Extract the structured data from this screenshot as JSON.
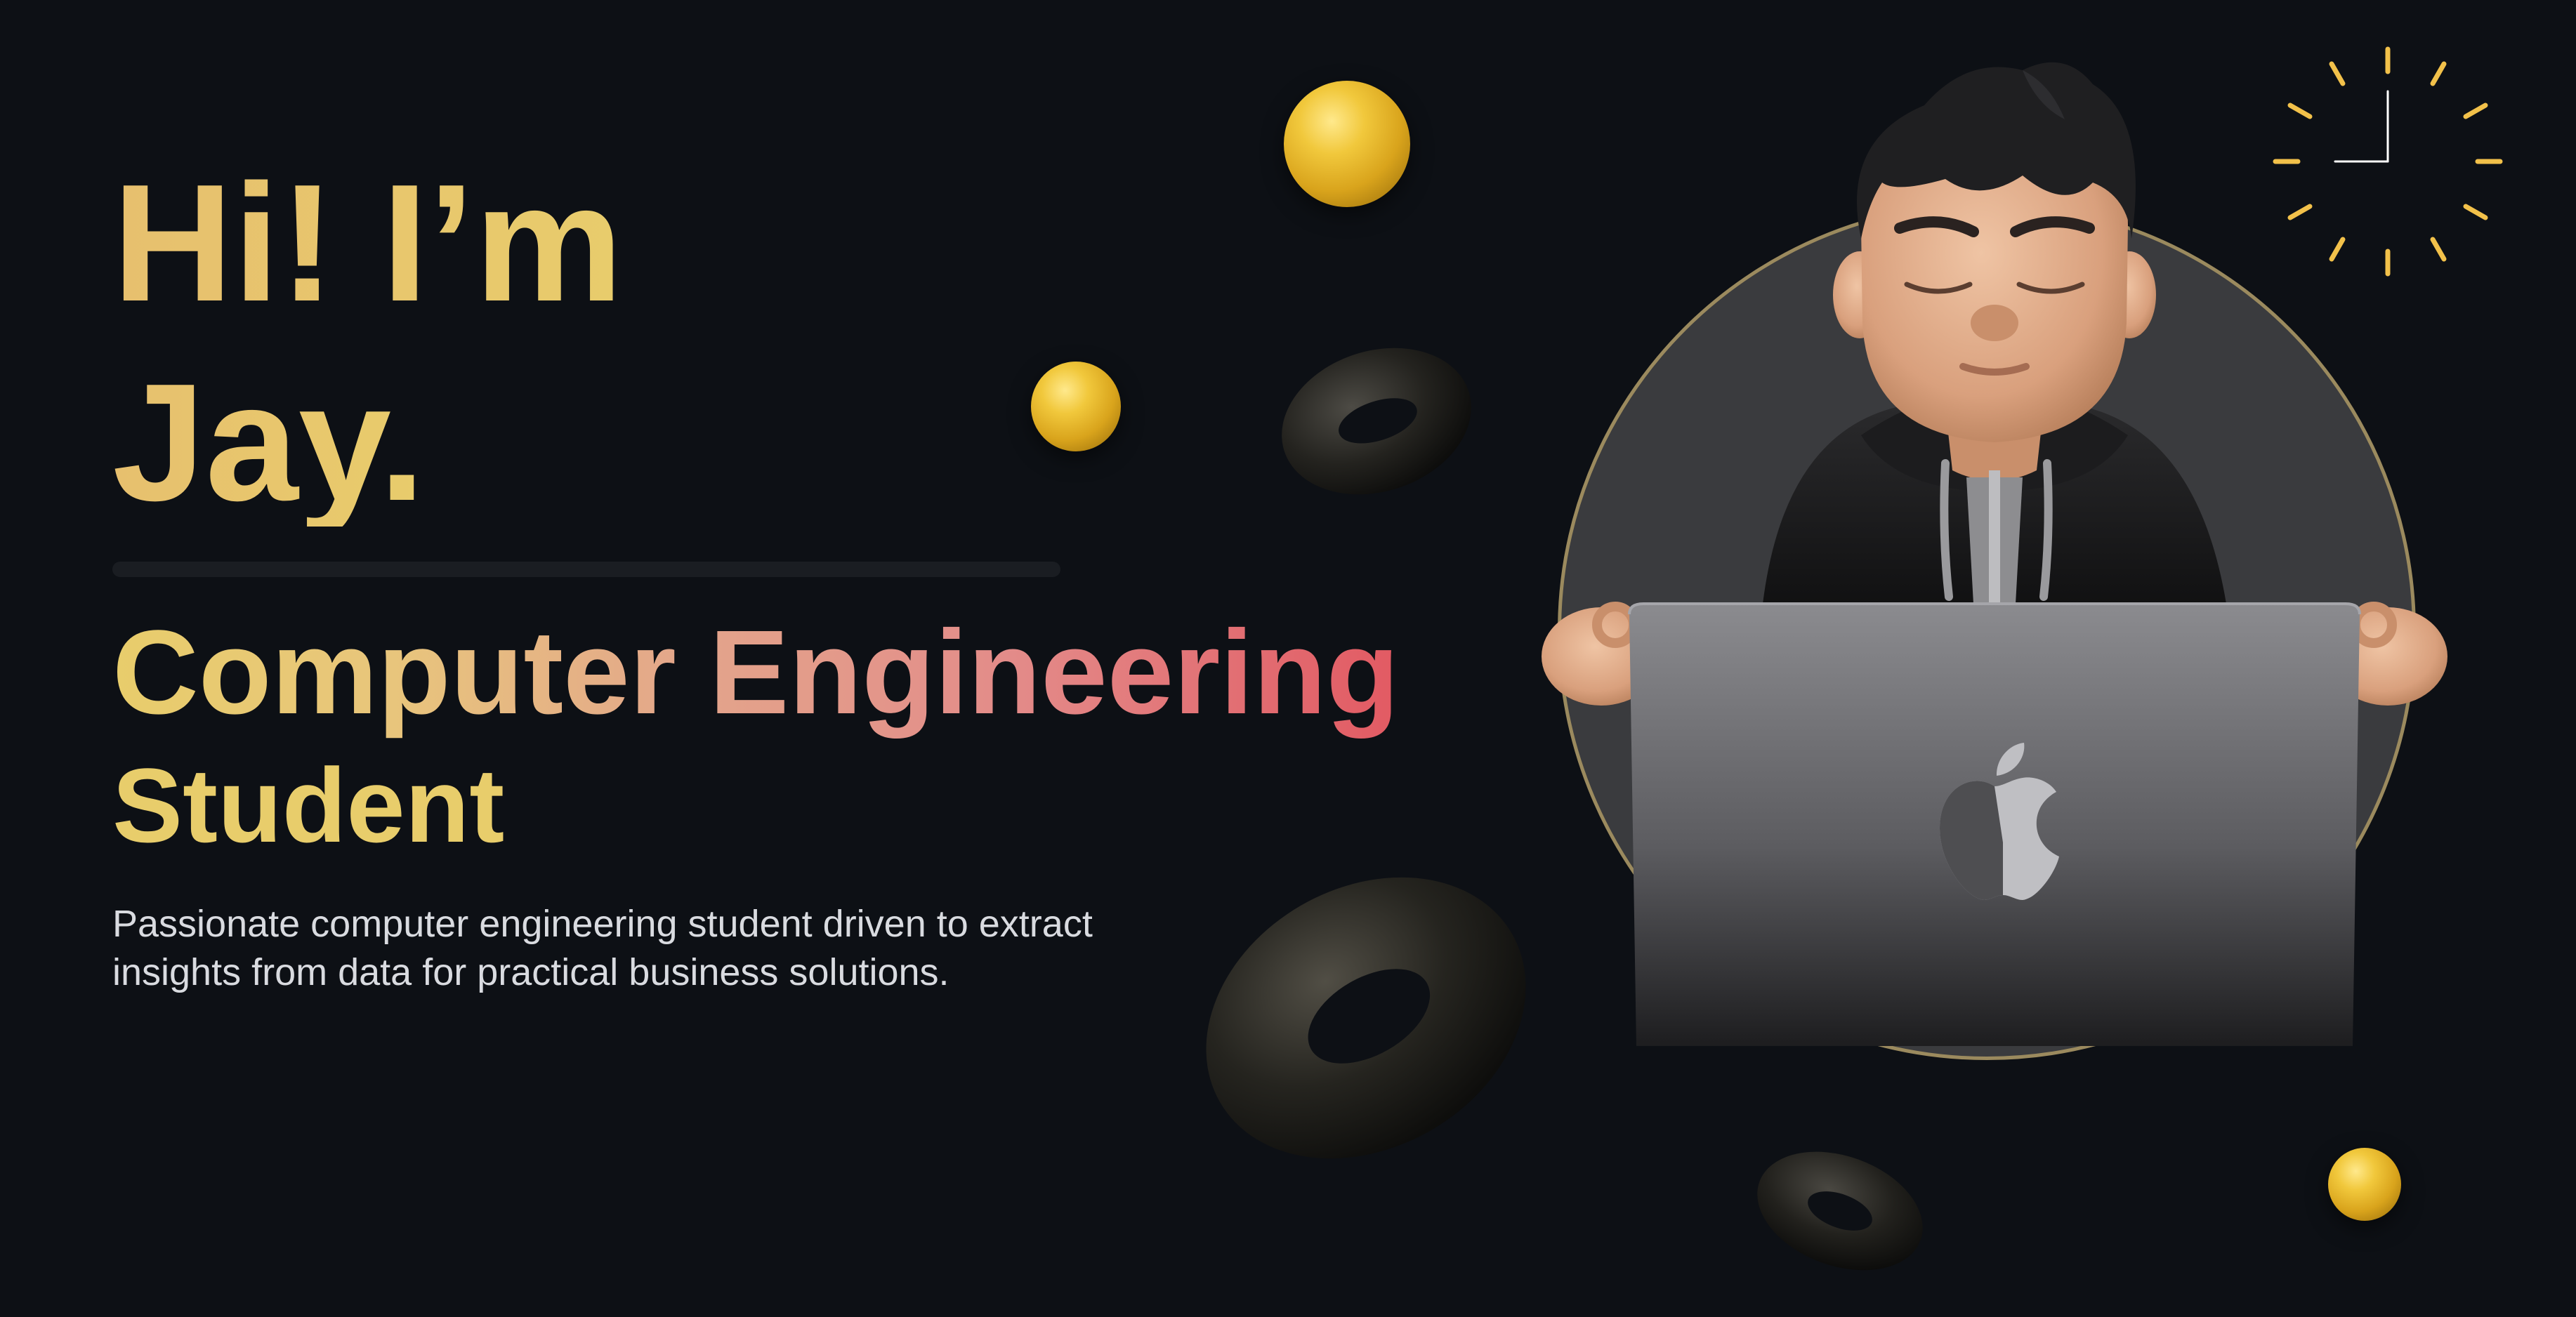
{
  "hero": {
    "greeting_line1": "Hi! I’m",
    "greeting_line2": "Jay.",
    "role_line1": "Computer Engineering",
    "role_line2": "Student",
    "tagline_line1": "Passionate computer engineering student driven to extract",
    "tagline_line2": "insights from data for practical business solutions."
  },
  "colors": {
    "background": "#0d1015",
    "accent_gold": "#e8cd6b",
    "accent_red": "#e25a63",
    "backdrop_circle": "#3a3b3e"
  },
  "icons": {
    "clock": "clock-icon",
    "avatar": "memoji-avatar",
    "laptop_logo": "apple-logo-icon"
  }
}
